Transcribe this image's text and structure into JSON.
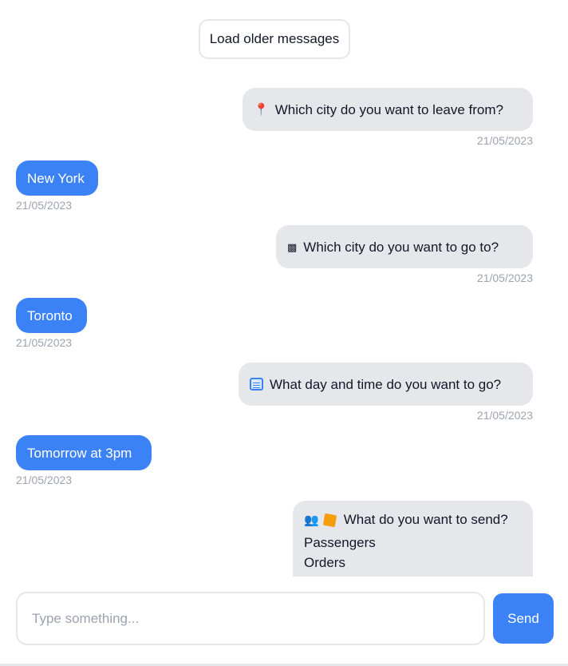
{
  "load_older_label": "Load older messages",
  "messages": [
    {
      "role": "bot",
      "icon": "pin-icon",
      "glyph": "📍",
      "text": "Which city do you want to leave from?",
      "time": "21/05/2023"
    },
    {
      "role": "user",
      "text": "New York",
      "time": "21/05/2023"
    },
    {
      "role": "bot",
      "icon": "checkered-flag-icon",
      "glyph": "🏁",
      "text": "Which city do you want to go to?",
      "time": "21/05/2023"
    },
    {
      "role": "user",
      "text": "Toronto",
      "time": "21/05/2023"
    },
    {
      "role": "bot",
      "icon": "calendar-icon",
      "text": "What day and time do you want to go?",
      "time": "21/05/2023"
    },
    {
      "role": "user",
      "text": "Tomorrow at 3pm",
      "time": "21/05/2023"
    }
  ],
  "send_question": {
    "icons": [
      "people-icon",
      "package-icon"
    ],
    "text": "What do you want to send?",
    "options": [
      "Passengers",
      "Orders"
    ]
  },
  "composer": {
    "placeholder": "Type something...",
    "value": "",
    "send_label": "Send"
  },
  "colors": {
    "user_bubble": "#3b82f6",
    "bot_bubble": "#e5e7eb",
    "timestamp": "#9ca3af"
  }
}
